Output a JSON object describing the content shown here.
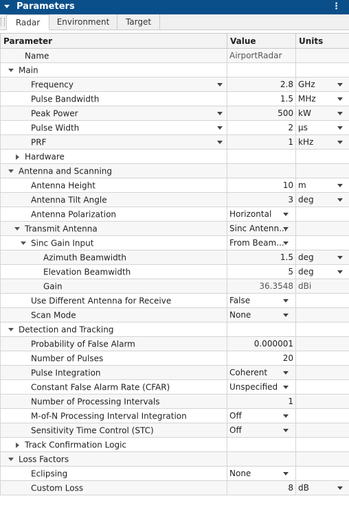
{
  "panel": {
    "title": "Parameters",
    "tabs": [
      "Radar",
      "Environment",
      "Target"
    ],
    "active_tab": "Radar"
  },
  "table": {
    "headers": {
      "parameter": "Parameter",
      "value": "Value",
      "units": "Units"
    },
    "rows": [
      {
        "level": 1,
        "label": "Name",
        "value": "AirportRadar",
        "value_kind": "readonly",
        "unit": "",
        "unit_kind": "none"
      },
      {
        "level": 0,
        "label": "Main",
        "toggle": "expanded",
        "value": "",
        "value_kind": "none",
        "unit": "",
        "unit_kind": "none"
      },
      {
        "level": 2,
        "label": "Frequency",
        "name_dropdown": true,
        "value": "2.8",
        "value_kind": "number",
        "unit": "GHz",
        "unit_kind": "dropdown"
      },
      {
        "level": 2,
        "label": "Pulse Bandwidth",
        "value": "1.5",
        "value_kind": "number",
        "unit": "MHz",
        "unit_kind": "dropdown"
      },
      {
        "level": 2,
        "label": "Peak Power",
        "name_dropdown": true,
        "value": "500",
        "value_kind": "number",
        "unit": "kW",
        "unit_kind": "dropdown"
      },
      {
        "level": 2,
        "label": "Pulse Width",
        "name_dropdown": true,
        "value": "2",
        "value_kind": "number",
        "unit": "μs",
        "unit_kind": "dropdown"
      },
      {
        "level": 2,
        "label": "PRF",
        "name_dropdown": true,
        "value": "1",
        "value_kind": "number",
        "unit": "kHz",
        "unit_kind": "dropdown"
      },
      {
        "level": 1,
        "label": "Hardware",
        "toggle": "collapsed",
        "value": "",
        "value_kind": "none",
        "unit": "",
        "unit_kind": "none"
      },
      {
        "level": 0,
        "label": "Antenna and Scanning",
        "toggle": "expanded",
        "value": "",
        "value_kind": "none",
        "unit": "",
        "unit_kind": "none"
      },
      {
        "level": 2,
        "label": "Antenna Height",
        "value": "10",
        "value_kind": "number",
        "unit": "m",
        "unit_kind": "dropdown"
      },
      {
        "level": 2,
        "label": "Antenna Tilt Angle",
        "value": "3",
        "value_kind": "number",
        "unit": "deg",
        "unit_kind": "dropdown"
      },
      {
        "level": 2,
        "label": "Antenna Polarization",
        "value": "Horizontal",
        "value_kind": "dropdown",
        "unit": "",
        "unit_kind": "none"
      },
      {
        "level": 1,
        "label": "Transmit Antenna",
        "toggle": "expanded",
        "value": "Sinc Antenn...",
        "value_kind": "dropdown",
        "unit": "",
        "unit_kind": "none"
      },
      {
        "level": 2,
        "label": "Sinc Gain Input",
        "toggle": "expanded",
        "value": "From Beam...",
        "value_kind": "dropdown",
        "unit": "",
        "unit_kind": "none"
      },
      {
        "level": 4,
        "label": "Azimuth Beamwidth",
        "value": "1.5",
        "value_kind": "number",
        "unit": "deg",
        "unit_kind": "dropdown"
      },
      {
        "level": 4,
        "label": "Elevation Beamwidth",
        "value": "5",
        "value_kind": "number",
        "unit": "deg",
        "unit_kind": "dropdown"
      },
      {
        "level": 4,
        "label": "Gain",
        "value": "36.3548",
        "value_kind": "readonly-number",
        "unit": "dBi",
        "unit_kind": "readonly"
      },
      {
        "level": 2,
        "label": "Use Different Antenna for Receive",
        "value": "False",
        "value_kind": "dropdown",
        "unit": "",
        "unit_kind": "none"
      },
      {
        "level": 2,
        "label": "Scan Mode",
        "value": "None",
        "value_kind": "dropdown",
        "unit": "",
        "unit_kind": "none"
      },
      {
        "level": 0,
        "label": "Detection and Tracking",
        "toggle": "expanded",
        "value": "",
        "value_kind": "none",
        "unit": "",
        "unit_kind": "none"
      },
      {
        "level": 2,
        "label": "Probability of False Alarm",
        "value": "0.000001",
        "value_kind": "number",
        "unit": "",
        "unit_kind": "none"
      },
      {
        "level": 2,
        "label": "Number of Pulses",
        "value": "20",
        "value_kind": "number",
        "unit": "",
        "unit_kind": "none"
      },
      {
        "level": 2,
        "label": "Pulse Integration",
        "value": "Coherent",
        "value_kind": "dropdown",
        "unit": "",
        "unit_kind": "none"
      },
      {
        "level": 2,
        "label": "Constant False Alarm Rate (CFAR)",
        "value": "Unspecified",
        "value_kind": "dropdown",
        "unit": "",
        "unit_kind": "none"
      },
      {
        "level": 2,
        "label": "Number of Processing Intervals",
        "value": "1",
        "value_kind": "number",
        "unit": "",
        "unit_kind": "none"
      },
      {
        "level": 2,
        "label": "M-of-N Processing Interval Integration",
        "value": "Off",
        "value_kind": "dropdown",
        "unit": "",
        "unit_kind": "none"
      },
      {
        "level": 2,
        "label": "Sensitivity Time Control (STC)",
        "value": "Off",
        "value_kind": "dropdown",
        "unit": "",
        "unit_kind": "none"
      },
      {
        "level": 1,
        "label": "Track Confirmation Logic",
        "toggle": "collapsed",
        "value": "",
        "value_kind": "none",
        "unit": "",
        "unit_kind": "none"
      },
      {
        "level": 0,
        "label": "Loss Factors",
        "toggle": "expanded",
        "value": "",
        "value_kind": "none",
        "unit": "",
        "unit_kind": "none"
      },
      {
        "level": 2,
        "label": "Eclipsing",
        "value": "None",
        "value_kind": "dropdown",
        "unit": "",
        "unit_kind": "none"
      },
      {
        "level": 2,
        "label": "Custom Loss",
        "value": "8",
        "value_kind": "number",
        "unit": "dB",
        "unit_kind": "dropdown"
      }
    ]
  }
}
